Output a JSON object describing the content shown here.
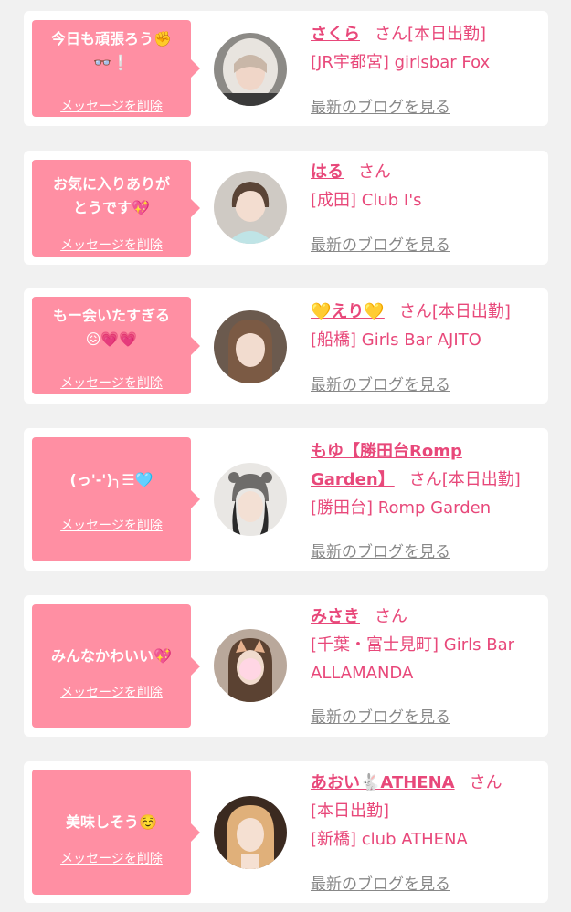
{
  "colors": {
    "accent": "#e8487a",
    "bubble": "#ff8fa3",
    "background": "#f1f1f1",
    "link_gray": "#888888"
  },
  "cards": [
    {
      "message": "今日も頑張ろう✊\n👓❕",
      "delete_label": "メッセージを削除",
      "name": "さくら",
      "honorific": "さん",
      "status": "[本日出勤]",
      "shop": "[JR宇都宮] girlsbar Fox",
      "blog_label": "最新のブログを見る"
    },
    {
      "message": "お気に入りありが\nとうです💖",
      "delete_label": "メッセージを削除",
      "name": "はる",
      "honorific": "さん",
      "status": "",
      "shop": "[成田] Club I's",
      "blog_label": "最新のブログを見る"
    },
    {
      "message": "もー会いたすぎる\n😖💗💗",
      "delete_label": "メッセージを削除",
      "name": "💛えり💛",
      "honorific": "さん",
      "status": "[本日出勤]",
      "shop": "[船橋] Girls Bar AJITO",
      "blog_label": "最新のブログを見る"
    },
    {
      "message": "(っ'-')╮☰🩵",
      "delete_label": "メッセージを削除",
      "name": "もゆ【勝田台Romp Garden】",
      "honorific": "さん",
      "status": "[本日出勤]",
      "shop": "[勝田台] Romp Garden",
      "blog_label": "最新のブログを見る"
    },
    {
      "message": "みんなかわいい💖",
      "delete_label": "メッセージを削除",
      "name": "みさき",
      "honorific": "さん",
      "status": "",
      "shop": "[千葉・富士見町] Girls Bar ALLAMANDA",
      "blog_label": "最新のブログを見る"
    },
    {
      "message": "美味しそう☺️",
      "delete_label": "メッセージを削除",
      "name": "あおい🐇ATHENA",
      "honorific": "さん",
      "status": "[本日出勤]",
      "shop": "[新橋] club ATHENA",
      "blog_label": "最新のブログを見る"
    }
  ]
}
